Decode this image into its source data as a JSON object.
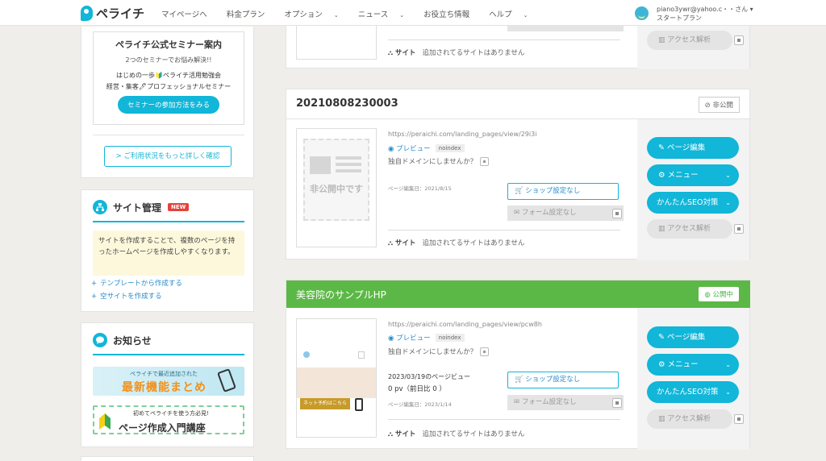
{
  "header": {
    "logo_text": "ペライチ",
    "nav": [
      {
        "label": "マイページへ",
        "caret": false
      },
      {
        "label": "料金プラン",
        "caret": false
      },
      {
        "label": "オプション",
        "caret": true
      },
      {
        "label": "ニュース",
        "caret": true
      },
      {
        "label": "お役立ち情報",
        "caret": false
      },
      {
        "label": "ヘルプ",
        "caret": true
      }
    ],
    "user_name": "piano3ywr@yahoo.c・・さん ▾",
    "user_plan": "スタートプラン"
  },
  "sidebar": {
    "seminar": {
      "title": "ペライチ公式セミナー案内",
      "subtitle": "2つのセミナーでお悩み解決!!",
      "line1": "はじめの一歩🔰ペライチ活用勉強会",
      "line2": "経営・集客🖊プロフェッショナルセミナー",
      "button": "セミナーの参加方法をみる"
    },
    "status_link": "> ご利用状況をもっと詳しく確認",
    "site_mgmt": {
      "title": "サイト管理",
      "badge": "NEW",
      "description": "サイトを作成することで、複数のページを持ったホームページを作成しやすくなります。",
      "link_template": "テンプレートから作成する",
      "link_empty": "空サイトを作成する"
    },
    "news": {
      "title": "お知らせ",
      "banner1_small": "ペライチで最近追加された",
      "banner1_big": "最新機能まとめ",
      "banner2_small": "初めてペライチを使う方必見!",
      "banner2_big": "ページ作成入門講座"
    }
  },
  "pages": {
    "top_partial": {
      "site_label": "サイト",
      "site_value": "追加されてるサイトはありません",
      "analytics": "アクセス解析"
    },
    "page2": {
      "title": "20210808230003",
      "status": "非公開",
      "thumb_text": "非公開中です",
      "url": "https://peraichi.com/landing_pages/view/29i3i",
      "preview": "プレビュー",
      "noindex": "noindex",
      "domain": "独自ドメインにしませんか？",
      "edited": "ページ編集日：2021/8/15",
      "shop": "ショップ設定なし",
      "form": "フォーム設定なし",
      "site_label": "サイト",
      "site_value": "追加されてるサイトはありません",
      "btn_edit": "ページ編集",
      "btn_menu": "メニュー",
      "btn_seo": "かんたんSEO対策",
      "btn_analytics": "アクセス解析"
    },
    "page3": {
      "title": "美容院のサンプルHP",
      "status": "公開中",
      "thumb_text": "ネット予約はこちら",
      "url": "https://peraichi.com/landing_pages/view/pcw8h",
      "preview": "プレビュー",
      "noindex": "noindex",
      "domain": "独自ドメインにしませんか？",
      "pv_label": "2023/03/19のページビュー",
      "pv_value": "0 pv（前日比 0 ）",
      "edited": "ページ編集日：2023/1/14",
      "shop": "ショップ設定なし",
      "form": "フォーム設定なし",
      "site_label": "サイト",
      "site_value": "追加されてるサイトはありません",
      "btn_edit": "ページ編集",
      "btn_menu": "メニュー",
      "btn_seo": "かんたんSEO対策",
      "btn_analytics": "アクセス解析"
    }
  }
}
